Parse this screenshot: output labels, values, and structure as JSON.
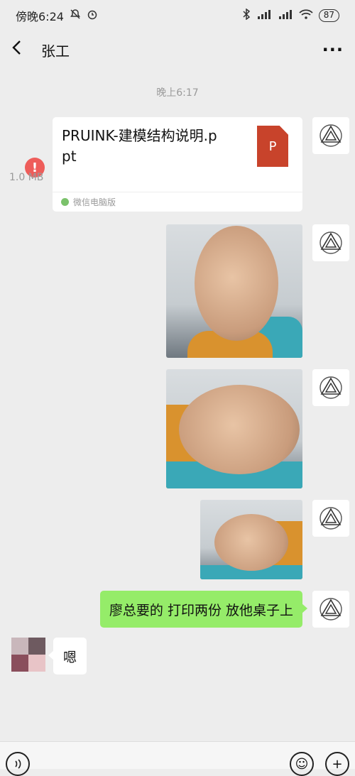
{
  "status_bar": {
    "time": "傍晚6:24",
    "battery": "87",
    "icons": [
      "bell-off-icon",
      "alarm-icon",
      "bluetooth-icon",
      "signal-icon",
      "signal-icon",
      "wifi-icon"
    ]
  },
  "nav": {
    "title": "张工",
    "back_icon": "chevron-left-icon",
    "more_icon": "more-icon",
    "more_label": "···"
  },
  "chat": {
    "timestamp": "晚上6:17",
    "file_message": {
      "name": "PRUINK-建模结构说明.ppt",
      "size": "1.0 MB",
      "source": "微信电脑版",
      "file_type": "P",
      "error_badge": "!"
    },
    "text_message_me": "廖总要的 打印两份 放他桌子上",
    "text_message_other": "嗯"
  },
  "colors": {
    "background": "#ededed",
    "sent_bubble": "#95ec69",
    "error": "#ee5d5a",
    "ppt": "#c8432b"
  },
  "bottom_bar": {
    "icons": [
      "voice-icon",
      "emoji-icon",
      "plus-icon"
    ],
    "emoji_glyph": "☺",
    "plus_glyph": "+"
  }
}
